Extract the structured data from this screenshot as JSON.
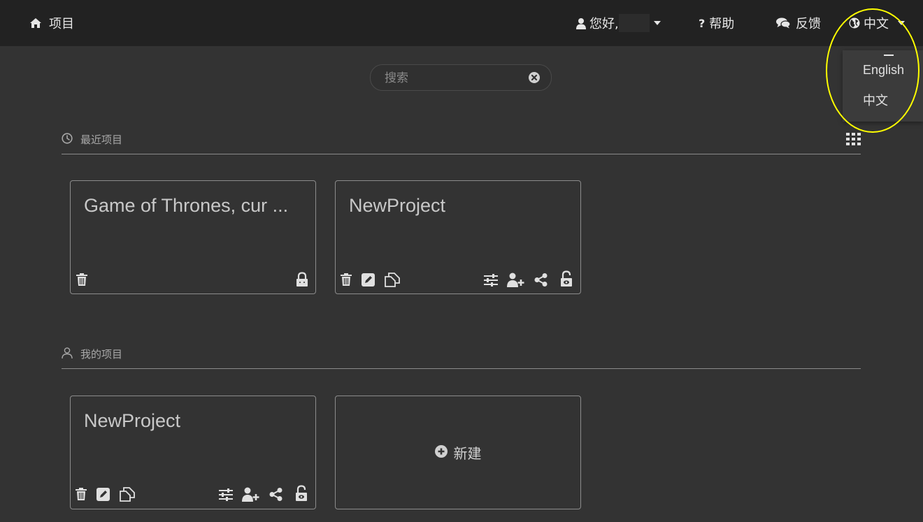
{
  "nav": {
    "home_label": "项目",
    "user_greeting": "您好,",
    "help_q": "?",
    "help_label": "帮助",
    "feedback_label": "反馈",
    "language_label": "中文"
  },
  "language_menu": {
    "options": [
      "English",
      "中文"
    ]
  },
  "search": {
    "placeholder": "搜索",
    "value": ""
  },
  "sections": {
    "recent": {
      "title": "最近项目",
      "cards": [
        {
          "title": "Game of Thrones, cur ..."
        },
        {
          "title": "NewProject"
        }
      ]
    },
    "mine": {
      "title": "我的项目",
      "cards": [
        {
          "title": "NewProject"
        }
      ],
      "new_label": "新建"
    }
  },
  "colors": {
    "background": "#333333",
    "topbar": "#222222",
    "highlight": "#ffff00",
    "card_border": "#8c8c8c"
  }
}
